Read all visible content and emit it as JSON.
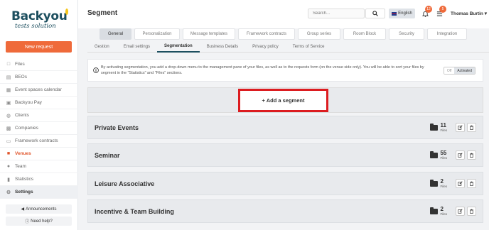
{
  "logo": {
    "main": "Backyou",
    "sub": "tests solution"
  },
  "sidebar": {
    "new_request": "New request",
    "items": [
      {
        "label": "Files",
        "icon": "file-icon"
      },
      {
        "label": "BEOs",
        "icon": "document-icon"
      },
      {
        "label": "Event spaces calendar",
        "icon": "calendar-icon"
      },
      {
        "label": "Backyou Pay",
        "icon": "card-icon"
      },
      {
        "label": "Clients",
        "icon": "handshake-icon"
      },
      {
        "label": "Companies",
        "icon": "building-icon"
      },
      {
        "label": "Framework contracts",
        "icon": "contract-icon"
      },
      {
        "label": "Venues",
        "icon": "venue-icon"
      },
      {
        "label": "Team",
        "icon": "team-icon"
      },
      {
        "label": "Statistics",
        "icon": "chart-icon"
      },
      {
        "label": "Settings",
        "icon": "gear-icon"
      }
    ],
    "announcements": "Announcements",
    "help": "Need help?"
  },
  "header": {
    "title": "Segment",
    "search_placeholder": "Search...",
    "language": "English",
    "notifications": "12",
    "tasks": "5",
    "user": "Thomas Burtin"
  },
  "tabs": [
    "General",
    "Personalization",
    "Message templates",
    "Framework contracts",
    "Group series",
    "Room Block",
    "Security",
    "Integration"
  ],
  "subtabs": [
    "Gestion",
    "Email settings",
    "Segmentation",
    "Business Details",
    "Privacy policy",
    "Terms of Service"
  ],
  "info": {
    "text": "By activating segmentation, you add a drop-down menu to the management pane of your files, as well as to the requests form (on the venue side only). You will be able to sort your files by segment in the \"Statistics\" and \"Files\" sections.",
    "toggle_off": "Off",
    "toggle_on": "Activated"
  },
  "add_segment": "+ Add a segment",
  "segments": [
    {
      "name": "Private Events",
      "count": "11",
      "label": "Files"
    },
    {
      "name": "Seminar",
      "count": "55",
      "label": "Files"
    },
    {
      "name": "Leisure Associative",
      "count": "2",
      "label": "Files"
    },
    {
      "name": "Incentive & Team Building",
      "count": "2",
      "label": "Files"
    }
  ],
  "colors": {
    "accent": "#ef6a3a",
    "brand": "#1d4f5f",
    "highlight": "#dc1c20"
  }
}
